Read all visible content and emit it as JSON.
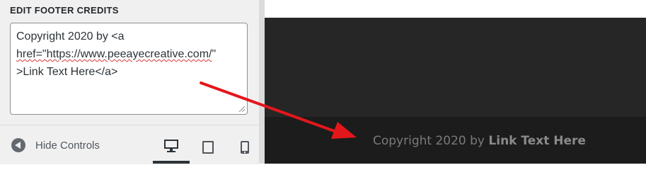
{
  "panel": {
    "section_title": "EDIT FOOTER CREDITS",
    "textarea": {
      "line1": "Copyright 2020 by <a",
      "line2_prefix": "href=\"",
      "line2_url": "https://www.peeayecreative.com/",
      "line2_suffix": "\"",
      "line3": ">Link Text Here</a>"
    },
    "hide_controls_label": "Hide Controls",
    "devices": [
      {
        "name": "desktop-icon",
        "active": true
      },
      {
        "name": "tablet-icon",
        "active": false
      },
      {
        "name": "mobile-icon",
        "active": false
      }
    ]
  },
  "preview": {
    "credit_prefix": "Copyright 2020 by ",
    "credit_link": "Link Text Here"
  },
  "colors": {
    "annotation_arrow": "#e3171b",
    "preview_main_bg": "#262626",
    "preview_footer_bg": "#1c1c1c"
  }
}
